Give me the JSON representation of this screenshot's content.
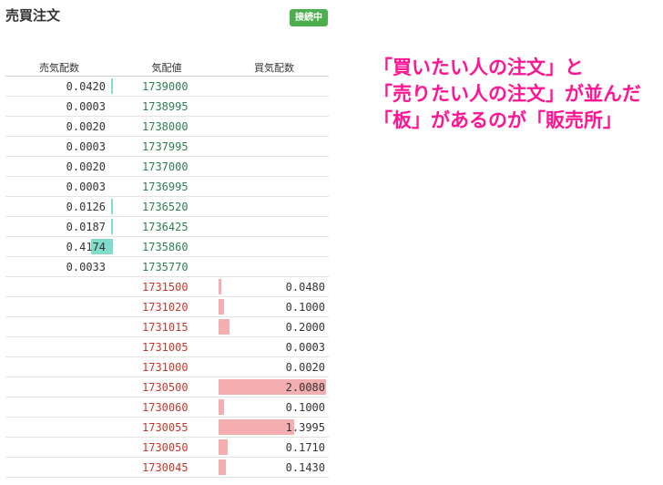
{
  "title": "売買注文",
  "status_badge": "接続中",
  "columns": {
    "sell": "売気配数",
    "price": "気配値",
    "buy": "買気配数"
  },
  "rows": [
    {
      "sell": "0.0420",
      "price": "1739000",
      "buy": "",
      "side": "sell",
      "level": 0.006
    },
    {
      "sell": "0.0003",
      "price": "1738995",
      "buy": "",
      "side": "sell",
      "level": 0.0
    },
    {
      "sell": "0.0020",
      "price": "1738000",
      "buy": "",
      "side": "sell",
      "level": 0.0
    },
    {
      "sell": "0.0003",
      "price": "1737995",
      "buy": "",
      "side": "sell",
      "level": 0.0
    },
    {
      "sell": "0.0020",
      "price": "1737000",
      "buy": "",
      "side": "sell",
      "level": 0.0
    },
    {
      "sell": "0.0003",
      "price": "1736995",
      "buy": "",
      "side": "sell",
      "level": 0.0
    },
    {
      "sell": "0.0126",
      "price": "1736520",
      "buy": "",
      "side": "sell",
      "level": 0.004
    },
    {
      "sell": "0.0187",
      "price": "1736425",
      "buy": "",
      "side": "sell",
      "level": 0.004
    },
    {
      "sell": "0.4174",
      "price": "1735860",
      "buy": "",
      "side": "sell",
      "level": 0.2
    },
    {
      "sell": "0.0033",
      "price": "1735770",
      "buy": "",
      "side": "sell",
      "level": 0.0
    },
    {
      "sell": "",
      "price": "1731500",
      "buy": "0.0480",
      "side": "buy",
      "level": 0.025
    },
    {
      "sell": "",
      "price": "1731020",
      "buy": "0.1000",
      "side": "buy",
      "level": 0.05
    },
    {
      "sell": "",
      "price": "1731015",
      "buy": "0.2000",
      "side": "buy",
      "level": 0.1
    },
    {
      "sell": "",
      "price": "1731005",
      "buy": "0.0003",
      "side": "buy",
      "level": 0.0
    },
    {
      "sell": "",
      "price": "1731000",
      "buy": "0.0020",
      "side": "buy",
      "level": 0.0
    },
    {
      "sell": "",
      "price": "1730500",
      "buy": "2.0080",
      "side": "buy",
      "level": 1.0
    },
    {
      "sell": "",
      "price": "1730060",
      "buy": "0.1000",
      "side": "buy",
      "level": 0.05
    },
    {
      "sell": "",
      "price": "1730055",
      "buy": "1.3995",
      "side": "buy",
      "level": 0.7
    },
    {
      "sell": "",
      "price": "1730050",
      "buy": "0.1710",
      "side": "buy",
      "level": 0.085
    },
    {
      "sell": "",
      "price": "1730045",
      "buy": "0.1430",
      "side": "buy",
      "level": 0.07
    }
  ],
  "annotation": [
    "「買いたい人の注文」と",
    "「売りたい人の注文」が並んだ",
    "「板」があるのが「販売所」"
  ],
  "colors": {
    "sell_bar": "#81dccb",
    "buy_bar": "#f5aeb0",
    "sell_price": "#2f7d55",
    "buy_price": "#c0392b",
    "annotation": "#ff1493",
    "badge": "#4cae4c"
  }
}
